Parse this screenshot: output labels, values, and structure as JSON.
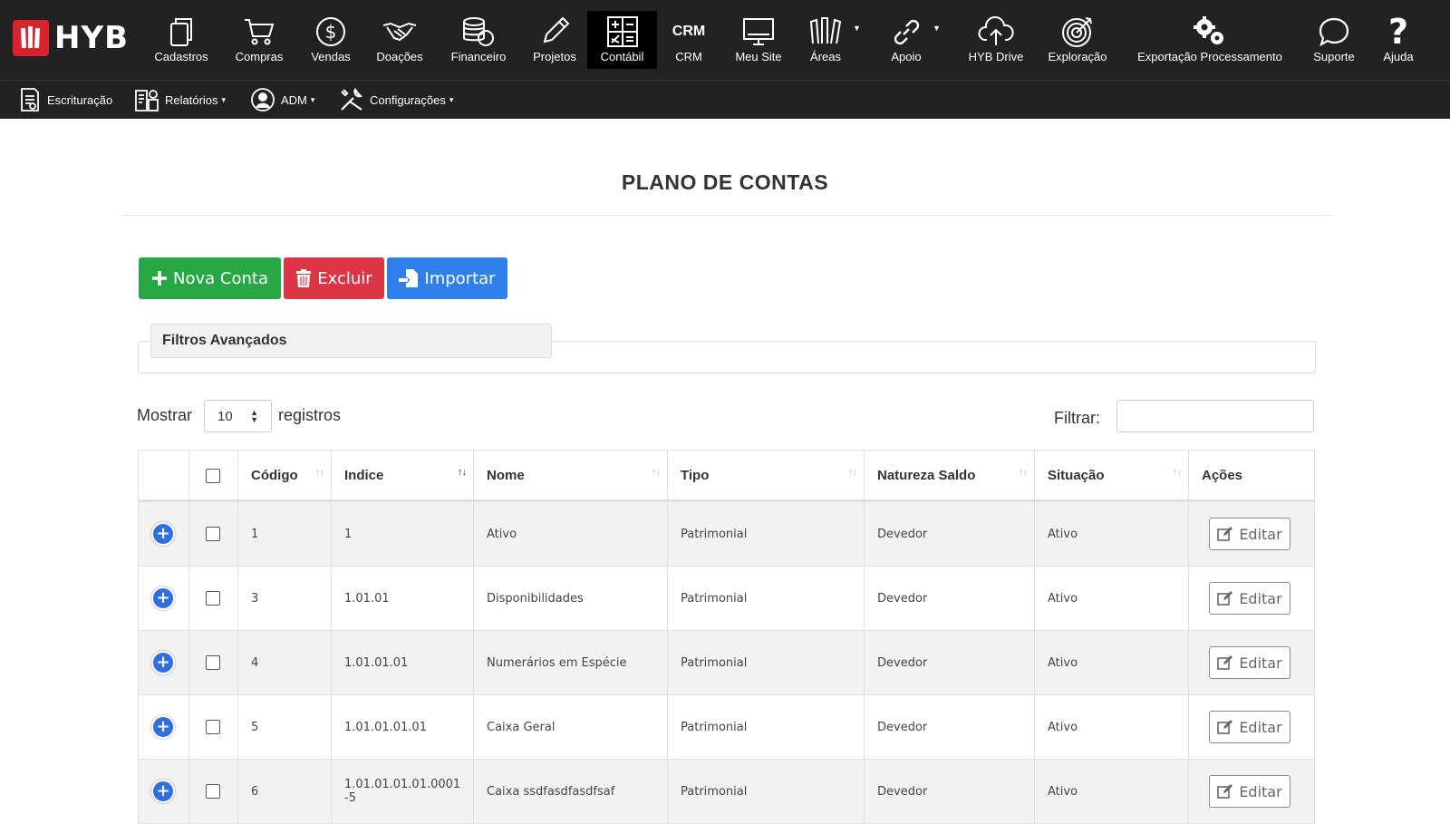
{
  "brand": {
    "name": "HYB",
    "color": "#d9232d"
  },
  "topnav": [
    {
      "label": "Cadastros",
      "icon": "copy-icon"
    },
    {
      "label": "Compras",
      "icon": "cart-icon"
    },
    {
      "label": "Vendas",
      "icon": "dollar-icon"
    },
    {
      "label": "Doações",
      "icon": "handshake-icon"
    },
    {
      "label": "Financeiro",
      "icon": "coins-icon"
    },
    {
      "label": "Projetos",
      "icon": "pencil-icon"
    },
    {
      "label": "Contábil",
      "icon": "calculator-icon",
      "active": true
    },
    {
      "label": "CRM",
      "icon_text": "CRM"
    },
    {
      "label": "Meu Site",
      "icon": "monitor-icon"
    },
    {
      "label": "Áreas",
      "icon": "areas-icon"
    },
    {
      "label": "Apoio",
      "icon": "link-icon"
    },
    {
      "label": "HYB Drive",
      "icon": "cloud-upload-icon"
    },
    {
      "label": "Exploração",
      "icon": "target-icon"
    },
    {
      "label": "Exportação Processamento",
      "icon": "gears-icon"
    },
    {
      "label": "Suporte",
      "icon": "chat-icon"
    },
    {
      "label": "Ajuda",
      "icon": "question-icon"
    }
  ],
  "subnav": [
    {
      "label": "Escrituração",
      "icon": "ledger-icon"
    },
    {
      "label": "Relatórios",
      "icon": "reports-icon",
      "caret": "▾"
    },
    {
      "label": "ADM",
      "icon": "user-circle-icon",
      "caret": "▾"
    },
    {
      "label": "Configurações",
      "icon": "tools-icon",
      "caret": "▾"
    }
  ],
  "page": {
    "title": "PLANO DE CONTAS",
    "buttons": {
      "new": "Nova Conta",
      "delete": "Excluir",
      "import": "Importar"
    },
    "filters_label": "Filtros Avançados",
    "show_label": "Mostrar",
    "page_length": "10",
    "records_label": "registros",
    "filter_label": "Filtrar:"
  },
  "table": {
    "headers": [
      "Código",
      "Indice",
      "Nome",
      "Tipo",
      "Natureza Saldo",
      "Situação",
      "Ações"
    ],
    "edit_label": "Editar",
    "rows": [
      {
        "codigo": "1",
        "indice": "1",
        "nome": "Ativo",
        "tipo": "Patrimonial",
        "natureza": "Devedor",
        "situacao": "Ativo"
      },
      {
        "codigo": "3",
        "indice": "1.01.01",
        "nome": "Disponibilidades",
        "tipo": "Patrimonial",
        "natureza": "Devedor",
        "situacao": "Ativo"
      },
      {
        "codigo": "4",
        "indice": "1.01.01.01",
        "nome": "Numerários em Espécie",
        "tipo": "Patrimonial",
        "natureza": "Devedor",
        "situacao": "Ativo"
      },
      {
        "codigo": "5",
        "indice": "1.01.01.01.01",
        "nome": "Caixa Geral",
        "tipo": "Patrimonial",
        "natureza": "Devedor",
        "situacao": "Ativo"
      },
      {
        "codigo": "6",
        "indice": "1.01.01.01.01.0001-5",
        "nome": "Caixa ssdfasdfasdfsaf",
        "tipo": "Patrimonial",
        "natureza": "Devedor",
        "situacao": "Ativo"
      }
    ]
  },
  "colors": {
    "success": "#28a745",
    "danger": "#dc3545",
    "primary": "#2f80ed",
    "nav_bg": "#222222"
  }
}
